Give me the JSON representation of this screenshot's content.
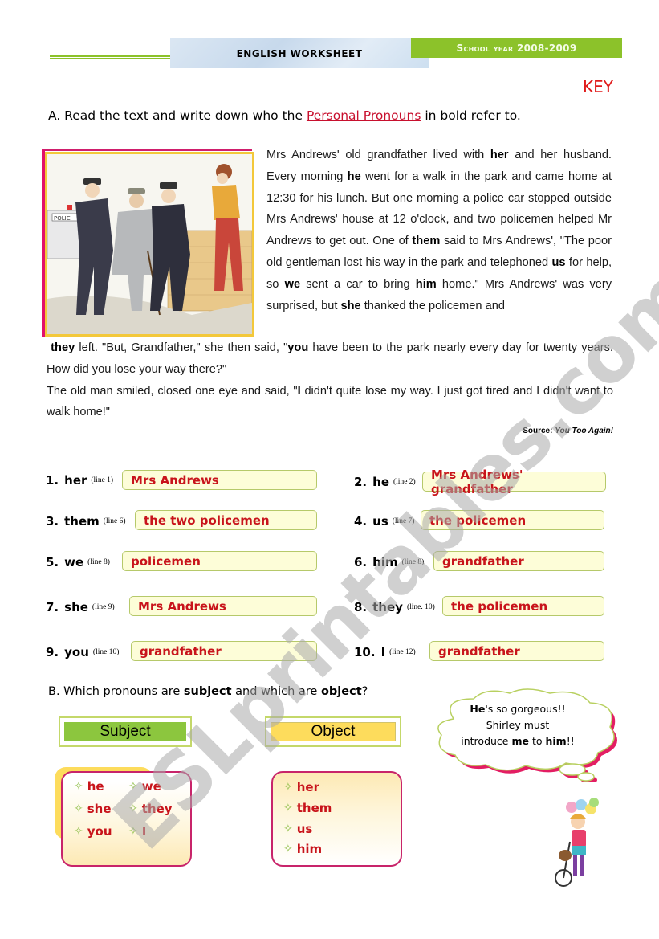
{
  "header": {
    "title": "ENGLISH WORKSHEET",
    "school_year": "School year 2008-2009",
    "key_label": "KEY"
  },
  "section_a": {
    "instruction_prefix": "A. Read the text and write down who the ",
    "instruction_highlight": "Personal Pronouns",
    "instruction_suffix": " in bold refer to.",
    "image_alt": "Illustration: two policemen helping an old man home while a woman talks to them",
    "story": {
      "p1_a": "Mrs Andrews' old grandfather lived with ",
      "p1_b1": "her",
      "p1_c": " and her husband. Every morning ",
      "p1_b2": "he",
      "p1_d": " went for a walk in the park and came home at 12:30 for his lunch. But one morning a police car stopped outside Mrs Andrews' house at 12 o'clock, and two policemen helped Mr Andrews to get out. One of ",
      "p1_b3": "them",
      "p1_e": " said to Mrs Andrews', \"The poor old gentleman lost his way in the park and telephoned ",
      "p1_b4": "us",
      "p1_f": " for help, so ",
      "p1_b5": "we",
      "p1_g": " sent a car to bring ",
      "p1_b6": "him",
      "p1_h": " home.\" Mrs Andrews' was very surprised, but ",
      "p1_b7": "she",
      "p1_i": " thanked the policemen and",
      "p2_b1": "they",
      "p2_a": " left. \"But, Grandfather,\" she then said, \"",
      "p2_b2": "you",
      "p2_b": " have been to the park nearly every day for twenty years. How did you lose your way there?\"",
      "p3_a": "The old man smiled, closed one eye and said, \"",
      "p3_b1": "I",
      "p3_b": " didn't quite lose my way. I just got tired and I didn't want to walk home!\""
    },
    "source_label": "Source: ",
    "source_title": "You Too Again!",
    "questions": [
      {
        "num": "1.",
        "word": "her",
        "line": "(line 1)",
        "answer": "Mrs Andrews"
      },
      {
        "num": "2.",
        "word": "he",
        "line": "(line 2)",
        "answer": "Mrs Andrews' grandfather"
      },
      {
        "num": "3.",
        "word": "them",
        "line": "(line 6)",
        "answer": "the two policemen"
      },
      {
        "num": "4.",
        "word": "us",
        "line": "(line 7)",
        "answer": "the policemen"
      },
      {
        "num": "5.",
        "word": "we",
        "line": "(line 8)",
        "answer": "policemen"
      },
      {
        "num": "6.",
        "word": "him",
        "line": "(line 8)",
        "answer": "grandfather"
      },
      {
        "num": "7.",
        "word": "she",
        "line": "(line 9)",
        "answer": "Mrs Andrews"
      },
      {
        "num": "8.",
        "word": "they",
        "line": "(line. 10)",
        "answer": "the policemen"
      },
      {
        "num": "9.",
        "word": "you",
        "line": "(line 10)",
        "answer": "grandfather"
      },
      {
        "num": "10.",
        "word": "I",
        "line": "(line 12)",
        "answer": "grandfather"
      }
    ]
  },
  "section_b": {
    "prefix": "B. Which pronouns are ",
    "subject_word": "subject",
    "middle": " and which are ",
    "object_word": "object",
    "suffix": "?",
    "subject_label": "Subject",
    "object_label": "Object",
    "subject_items": [
      "he",
      "we",
      "she",
      "they",
      "you",
      "I"
    ],
    "object_items": [
      "her",
      "them",
      "us",
      "him"
    ],
    "bullet_icon": "✧"
  },
  "bubble": {
    "l1_bold": "He",
    "l1_rest": "'s so gorgeous!!",
    "l2": "Shirley must",
    "l3_a": "introduce ",
    "l3_b1": "me",
    "l3_c": " to ",
    "l3_b2": "him",
    "l3_d": "!!"
  },
  "watermark": "ESLprintables.com",
  "colors": {
    "accent_green": "#8cc22a",
    "answer_red": "#c8141b",
    "key_red": "#e01b1b",
    "border_magenta": "#c8246a",
    "answer_bg": "#fdfdd8",
    "object_yellow": "#fddc5c"
  }
}
